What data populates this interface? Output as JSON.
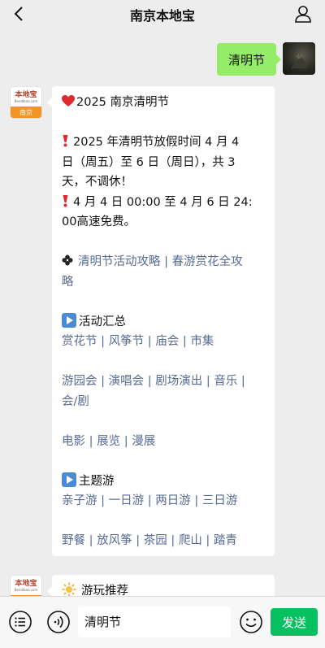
{
  "header": {
    "title": "南京本地宝"
  },
  "outgoing": {
    "text": "清明节"
  },
  "bot": {
    "logo_main": "本地宝",
    "logo_sub": "Bendibao.com",
    "logo_city": "南京"
  },
  "message": {
    "title": "2025 南京清明节",
    "holiday_l1": "2025 年清明节放假时间 4 月 4",
    "holiday_l2": "日（周五）至 6 日（周日），共 3",
    "holiday_l3": "天，不调休！",
    "toll_l1": "4 月 4 日 00:00 至 4 月 6 日 24:",
    "toll_l2": "00高速免费。",
    "guide_link1": "清明节活动攻略",
    "guide_link2_a": "春游赏花全攻",
    "guide_link2_b": "略",
    "activities_heading": "活动汇总",
    "activities_row1": [
      "赏花节",
      "风筝节",
      "庙会",
      "市集"
    ],
    "activities_row2_a": [
      "游园会",
      "演唱会",
      "剧场演出",
      "音乐"
    ],
    "activities_row2_b": "会/剧",
    "activities_row3": [
      "电影",
      "展览",
      "漫展"
    ],
    "theme_heading": "主题游",
    "theme_row1": [
      "亲子游",
      "一日游",
      "两日游",
      "三日游"
    ],
    "theme_row2": [
      "野餐",
      "放风筝",
      "茶园",
      "爬山",
      "踏青"
    ]
  },
  "second_message": {
    "title": "游玩推荐"
  },
  "bottom": {
    "input_value": "清明节",
    "send_label": "发送"
  },
  "colors": {
    "link": "#576b95",
    "outgoing_bubble": "#95ec69",
    "send_button": "#07c160",
    "logo_orange": "#f29525"
  }
}
